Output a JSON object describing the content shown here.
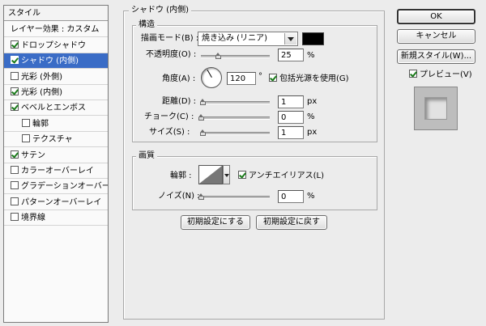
{
  "sidebar": {
    "header": "スタイル",
    "items": [
      {
        "label": "レイヤー効果 : カスタム",
        "checkbox": false,
        "checked": false,
        "selected": false,
        "sub": false
      },
      {
        "label": "ドロップシャドウ",
        "checkbox": true,
        "checked": true,
        "selected": false,
        "sub": false
      },
      {
        "label": "シャドウ (内側)",
        "checkbox": true,
        "checked": true,
        "selected": true,
        "sub": false
      },
      {
        "label": "光彩 (外側)",
        "checkbox": true,
        "checked": false,
        "selected": false,
        "sub": false
      },
      {
        "label": "光彩 (内側)",
        "checkbox": true,
        "checked": true,
        "selected": false,
        "sub": false
      },
      {
        "label": "ベベルとエンボス",
        "checkbox": true,
        "checked": true,
        "selected": false,
        "sub": false
      },
      {
        "label": "輪郭",
        "checkbox": true,
        "checked": false,
        "selected": false,
        "sub": true
      },
      {
        "label": "テクスチャ",
        "checkbox": true,
        "checked": false,
        "selected": false,
        "sub": true
      },
      {
        "label": "サテン",
        "checkbox": true,
        "checked": true,
        "selected": false,
        "sub": false
      },
      {
        "label": "カラーオーバーレイ",
        "checkbox": true,
        "checked": false,
        "selected": false,
        "sub": false
      },
      {
        "label": "グラデーションオーバーレイ",
        "checkbox": true,
        "checked": false,
        "selected": false,
        "sub": false
      },
      {
        "label": "パターンオーバーレイ",
        "checkbox": true,
        "checked": false,
        "selected": false,
        "sub": false
      },
      {
        "label": "境界線",
        "checkbox": true,
        "checked": false,
        "selected": false,
        "sub": false
      }
    ]
  },
  "panel": {
    "title": "シャドウ (内側)",
    "structure": {
      "title": "構造",
      "blend_mode_label": "描画モード(B) :",
      "blend_mode_value": "焼き込み (リニア)",
      "shadow_color": "#000000",
      "opacity_label": "不透明度(O) :",
      "opacity_value": "25",
      "opacity_fraction": 0.25,
      "opacity_unit": "%",
      "angle_label": "角度(A) :",
      "angle_value": "120",
      "angle_unit": "°",
      "global_light_label": "包括光源を使用(G)",
      "global_light_checked": true,
      "distance_label": "距離(D) :",
      "distance_value": "1",
      "distance_unit": "px",
      "choke_label": "チョーク(C) :",
      "choke_value": "0",
      "choke_unit": "%",
      "size_label": "サイズ(S) :",
      "size_value": "1",
      "size_unit": "px"
    },
    "quality": {
      "title": "画質",
      "contour_label": "輪郭 :",
      "antialias_label": "アンチエイリアス(L)",
      "antialias_checked": true,
      "noise_label": "ノイズ(N) :",
      "noise_value": "0",
      "noise_unit": "%"
    },
    "make_default_label": "初期設定にする",
    "reset_default_label": "初期設定に戻す"
  },
  "actions": {
    "ok_label": "OK",
    "cancel_label": "キャンセル",
    "new_style_label": "新規スタイル(W)...",
    "preview_label": "プレビュー(V)",
    "preview_checked": true
  },
  "icons": {
    "dropdown": "chevron-down-icon",
    "checkbox": "checkmark-icon",
    "angle_dial": "angle-dial-icon",
    "contour": "contour-curve-icon"
  },
  "colors": {
    "selection": "#3a6cc6",
    "check": "#1a7a1a",
    "panel_bg": "#ececec"
  }
}
